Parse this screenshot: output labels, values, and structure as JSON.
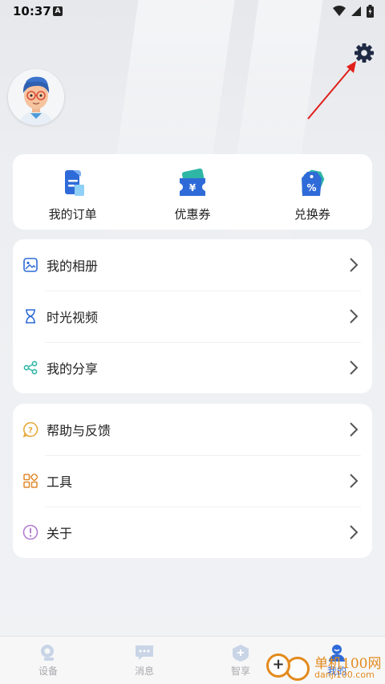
{
  "status_bar": {
    "time": "10:37",
    "notif_glyph": "A"
  },
  "shortcuts": [
    {
      "label": "我的订单",
      "icon": "order-icon"
    },
    {
      "label": "优惠券",
      "icon": "coupon-icon"
    },
    {
      "label": "兑换券",
      "icon": "voucher-icon"
    }
  ],
  "menu_group_1": [
    {
      "label": "我的相册",
      "icon": "album-icon"
    },
    {
      "label": "时光视频",
      "icon": "hourglass-icon"
    },
    {
      "label": "我的分享",
      "icon": "share-icon"
    }
  ],
  "menu_group_2": [
    {
      "label": "帮助与反馈",
      "icon": "help-icon"
    },
    {
      "label": "工具",
      "icon": "tools-icon"
    },
    {
      "label": "关于",
      "icon": "about-icon"
    }
  ],
  "bottom_nav": [
    {
      "label": "设备",
      "icon": "device-icon",
      "active": false
    },
    {
      "label": "消息",
      "icon": "message-icon",
      "active": false
    },
    {
      "label": "智享",
      "icon": "smart-share-icon",
      "active": false
    },
    {
      "label": "我的",
      "icon": "profile-icon",
      "active": true
    }
  ],
  "watermark": {
    "text": "单机100网",
    "url": "danji100.com",
    "glyph": "+"
  },
  "colors": {
    "accent": "#2f6bd8",
    "annotation": "#e0201b",
    "watermark": "#e38a1c",
    "help": "#e6a93a",
    "tools": "#e0892b",
    "about": "#b37fd1",
    "share": "#2fb7a6"
  }
}
